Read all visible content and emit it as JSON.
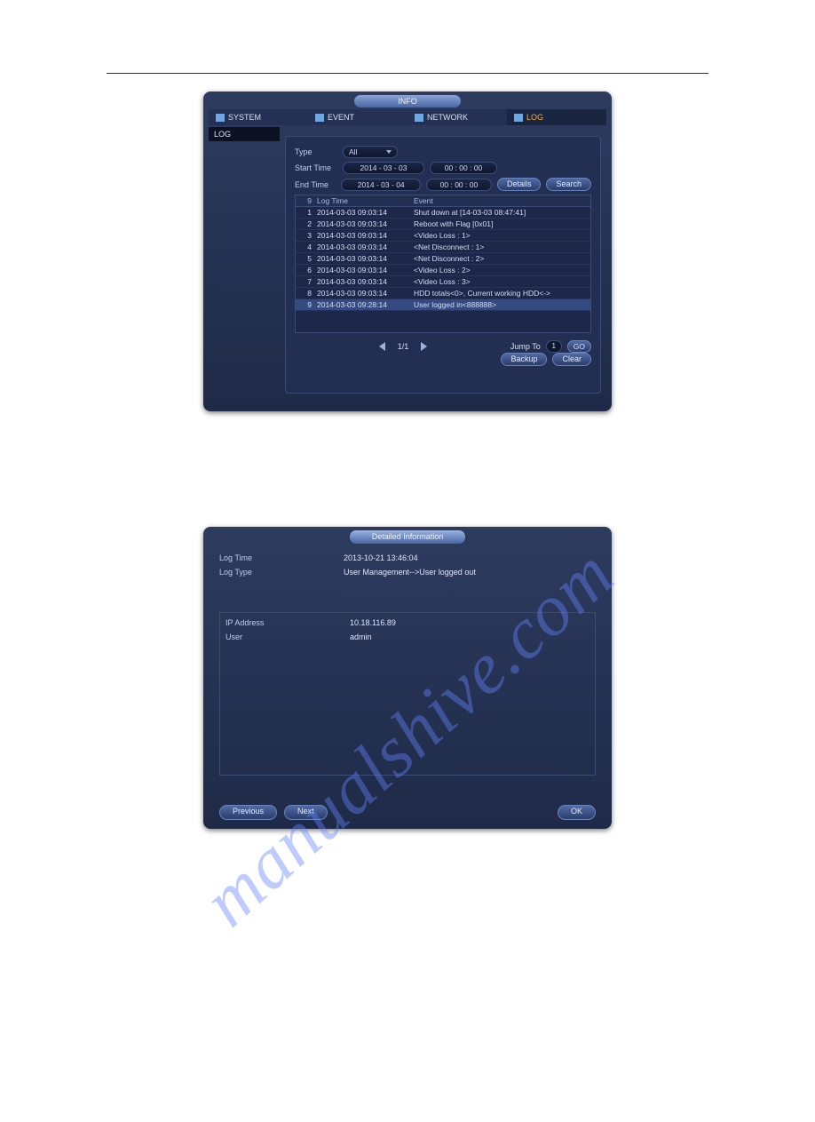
{
  "watermark": "manualshive.com",
  "top": {
    "title": "INFO",
    "tabs": [
      "SYSTEM",
      "EVENT",
      "NETWORK",
      "LOG"
    ],
    "active_tab_index": 3,
    "sidebar": {
      "items": [
        "LOG"
      ]
    },
    "filters": {
      "type_label": "Type",
      "type_value": "All",
      "start_label": "Start Time",
      "start_date": "2014 - 03 - 03",
      "start_time": "00 : 00 : 00",
      "end_label": "End Time",
      "end_date": "2014 - 03 - 04",
      "end_time": "00 : 00 : 00",
      "details_btn": "Details",
      "search_btn": "Search"
    },
    "table": {
      "count_header": "9",
      "headers": [
        "Log Time",
        "Event"
      ],
      "rows": [
        {
          "idx": "1",
          "time": "2014-03-03 09:03:14",
          "event": "Shut down at [14-03-03 08:47:41]"
        },
        {
          "idx": "2",
          "time": "2014-03-03 09:03:14",
          "event": "Reboot with Flag [0x01]"
        },
        {
          "idx": "3",
          "time": "2014-03-03 09:03:14",
          "event": "<Video Loss : 1>"
        },
        {
          "idx": "4",
          "time": "2014-03-03 09:03:14",
          "event": "<Net Disconnect : 1>"
        },
        {
          "idx": "5",
          "time": "2014-03-03 09:03:14",
          "event": "<Net Disconnect : 2>"
        },
        {
          "idx": "6",
          "time": "2014-03-03 09:03:14",
          "event": "<Video Loss : 2>"
        },
        {
          "idx": "7",
          "time": "2014-03-03 09:03:14",
          "event": "<Video Loss : 3>"
        },
        {
          "idx": "8",
          "time": "2014-03-03 09:03:14",
          "event": "HDD totals<0>, Current working HDD<->"
        },
        {
          "idx": "9",
          "time": "2014-03-03 09:28:14",
          "event": "User logged in<888888>"
        }
      ],
      "selected_index": 8
    },
    "footer": {
      "backup_btn": "Backup",
      "clear_btn": "Clear",
      "pager": "1/1",
      "jump_label": "Jump To",
      "jump_value": "1",
      "go_btn": "GO"
    }
  },
  "bottom": {
    "title": "Detailed Information",
    "rows": [
      {
        "label": "Log Time",
        "value": "2013-10-21 13:46:04"
      },
      {
        "label": "Log Type",
        "value": "User Management-->User logged out"
      }
    ],
    "box": [
      {
        "label": "IP Address",
        "value": "10.18.116.89"
      },
      {
        "label": "User",
        "value": "admin"
      }
    ],
    "buttons": {
      "previous": "Previous",
      "next": "Next",
      "ok": "OK"
    }
  }
}
